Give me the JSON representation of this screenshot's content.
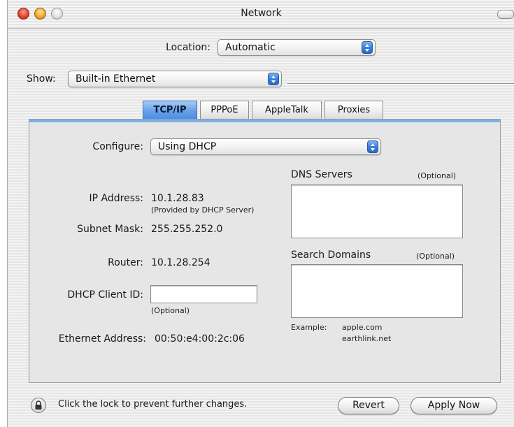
{
  "window": {
    "title": "Network"
  },
  "location": {
    "label": "Location:",
    "value": "Automatic"
  },
  "show": {
    "label": "Show:",
    "value": "Built-in Ethernet"
  },
  "tabs": [
    {
      "label": "TCP/IP",
      "active": true
    },
    {
      "label": "PPPoE",
      "active": false
    },
    {
      "label": "AppleTalk",
      "active": false
    },
    {
      "label": "Proxies",
      "active": false
    }
  ],
  "tcpip": {
    "configure": {
      "label": "Configure:",
      "value": "Using DHCP"
    },
    "ip_address": {
      "label": "IP Address:",
      "value": "10.1.28.83",
      "note": "(Provided by DHCP Server)"
    },
    "subnet_mask": {
      "label": "Subnet Mask:",
      "value": "255.255.252.0"
    },
    "router": {
      "label": "Router:",
      "value": "10.1.28.254"
    },
    "dhcp_client_id": {
      "label": "DHCP Client ID:",
      "value": "",
      "note": "(Optional)"
    },
    "ethernet_address": {
      "label": "Ethernet Address:",
      "value": "00:50:e4:00:2c:06"
    },
    "dns_servers": {
      "label": "DNS Servers",
      "note": "(Optional)"
    },
    "search_domains": {
      "label": "Search Domains",
      "note": "(Optional)"
    },
    "example": {
      "label": "Example:",
      "line1": "apple.com",
      "line2": "earthlink.net"
    }
  },
  "footer": {
    "lock_text": "Click the lock to prevent further changes.",
    "revert_label": "Revert",
    "apply_label": "Apply Now"
  },
  "icons": {
    "close": "close-button-icon",
    "minimize": "minimize-button-icon",
    "zoom": "zoom-button-icon",
    "toolbar": "toolbar-toggle-icon",
    "lock": "lock-icon",
    "stepper": "popup-arrows-icon"
  },
  "colors": {
    "tab_active": "#5b98e6",
    "stepper": "#3a7fd8"
  }
}
